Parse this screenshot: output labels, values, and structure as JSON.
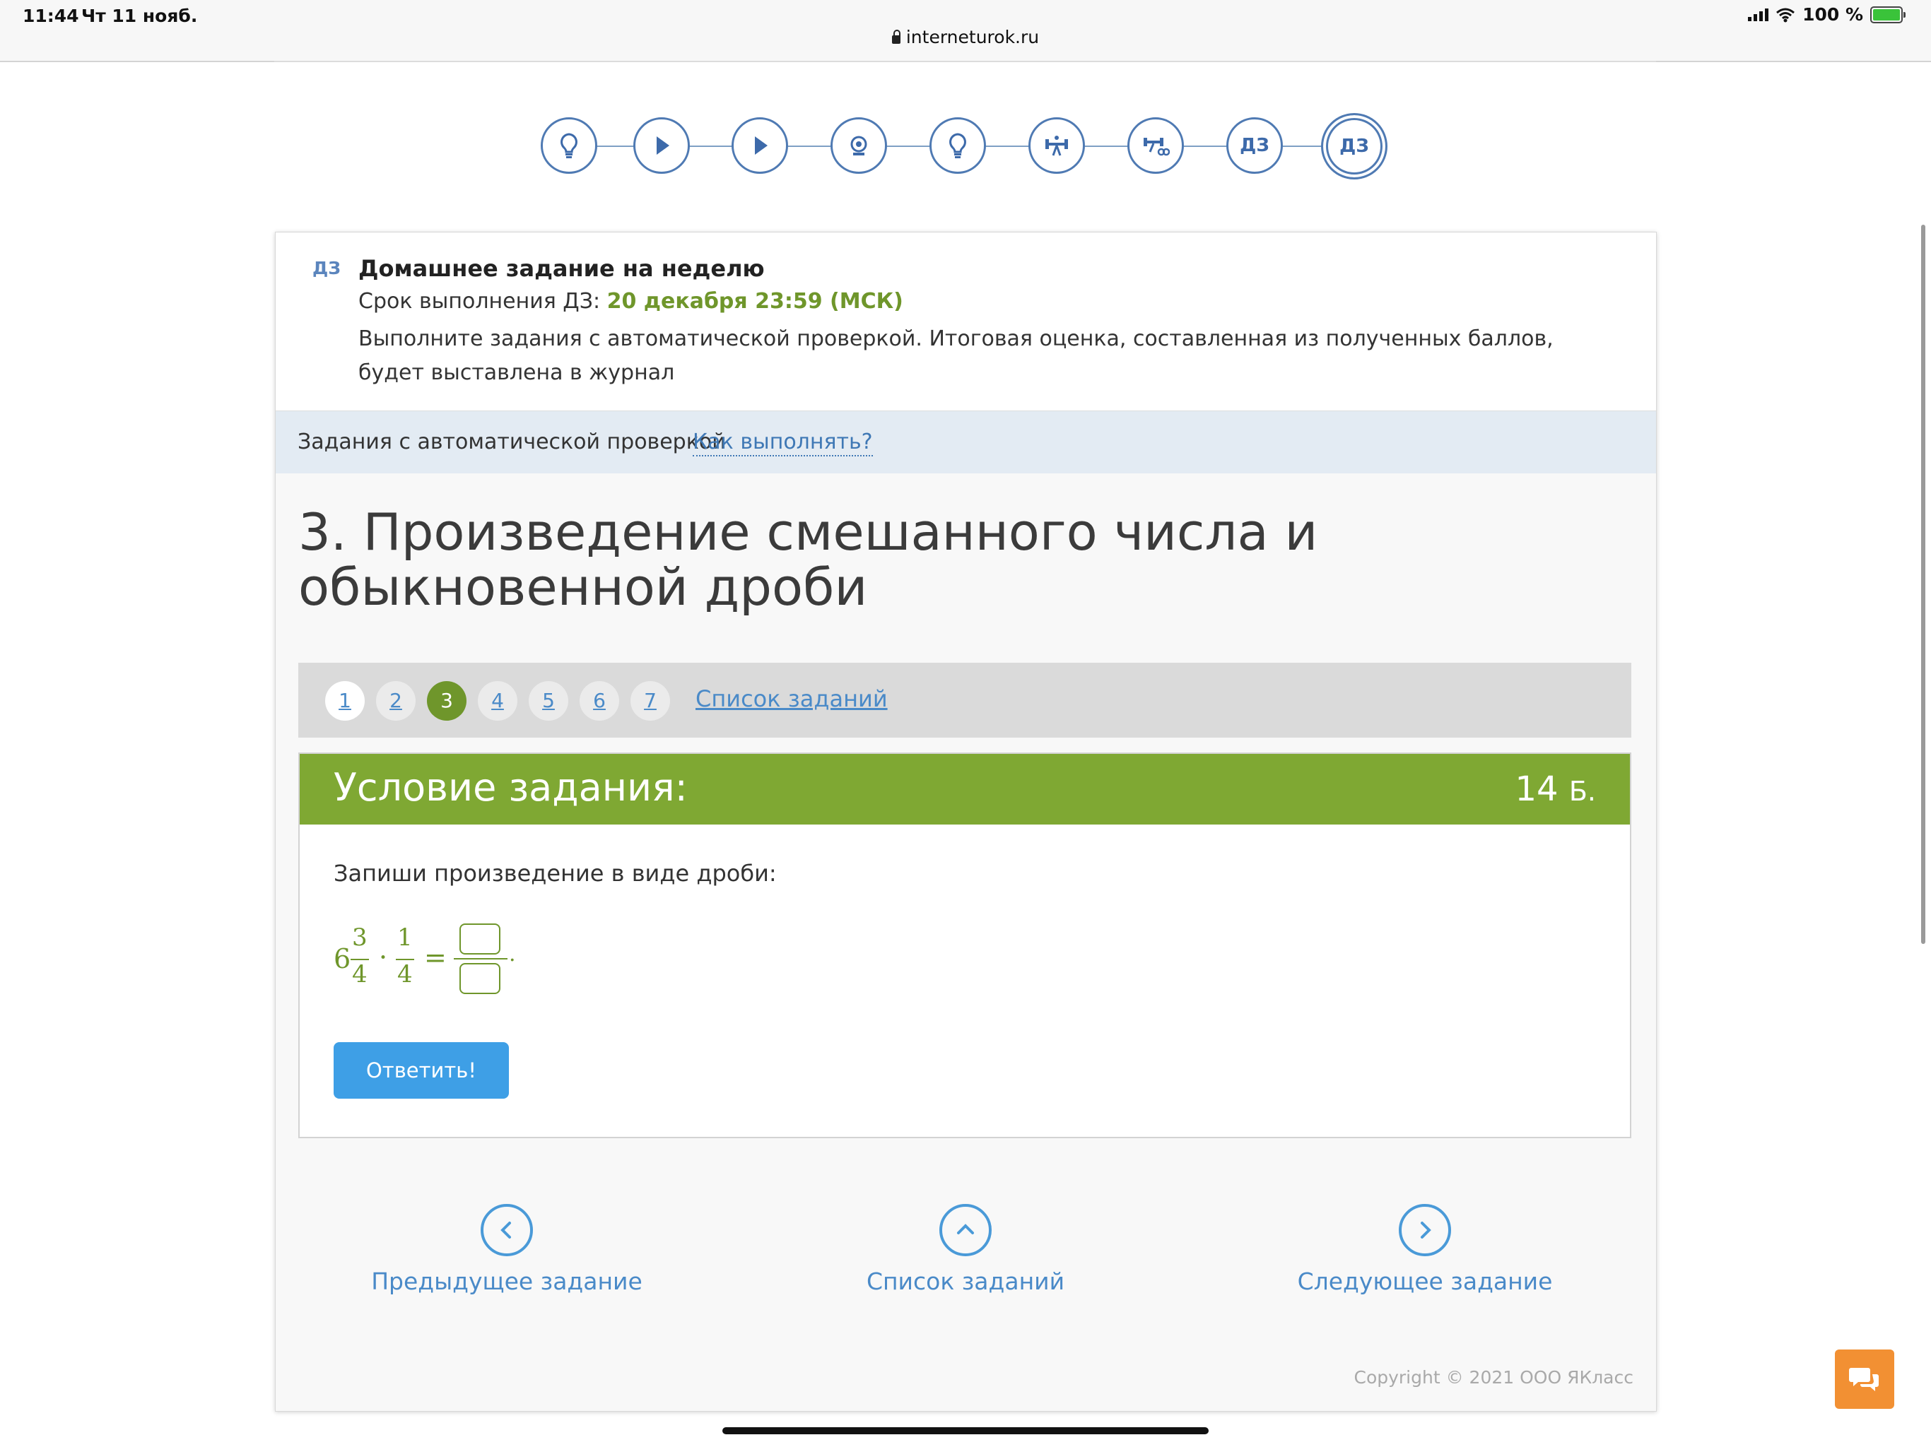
{
  "status_bar": {
    "time": "11:44",
    "date": "Чт 11 нояб.",
    "url": "interneturok.ru",
    "battery": "100 %"
  },
  "steps": [
    {
      "icon": "lightbulb-icon",
      "label": ""
    },
    {
      "icon": "play-icon",
      "label": ""
    },
    {
      "icon": "play-icon",
      "label": ""
    },
    {
      "icon": "webcam-icon",
      "label": ""
    },
    {
      "icon": "lightbulb-icon",
      "label": ""
    },
    {
      "icon": "dumbbell-icon",
      "label": ""
    },
    {
      "icon": "dumbbell-infinity-icon",
      "label": ""
    },
    {
      "icon": "homework-icon",
      "label": "ДЗ"
    },
    {
      "icon": "homework-icon",
      "label": "ДЗ",
      "active": true
    }
  ],
  "homework": {
    "tag": "ДЗ",
    "title": "Домашнее задание на неделю",
    "deadline_label": "Срок выполнения ДЗ: ",
    "deadline_value": "20 декабря 23:59 (МСК)",
    "description": "Выполните задания с автоматической проверкой. Итоговая оценка, составленная из полученных баллов, будет выставлена в журнал"
  },
  "auto_bar": {
    "label": "Задания с автоматической проверкой",
    "how_link": "Как выполнять?"
  },
  "task": {
    "title": "3. Произведение смешанного числа и обыкновенной дроби"
  },
  "pager": {
    "pages": [
      "1",
      "2",
      "3",
      "4",
      "5",
      "6",
      "7"
    ],
    "current": "3",
    "list_link": "Список заданий"
  },
  "condition": {
    "header": "Условие задания:",
    "points_value": "14",
    "points_unit": "Б.",
    "text": "Запиши произведение в виде дроби:",
    "math": {
      "whole": "6",
      "num1": "3",
      "den1": "4",
      "dot": "·",
      "num2": "1",
      "den2": "4",
      "equals": "=",
      "period": "."
    },
    "answer_numerator": "",
    "answer_denominator": "",
    "submit_label": "Ответить!"
  },
  "bottom_nav": {
    "prev": "Предыдущее задание",
    "list": "Список заданий",
    "next": "Следующее задание"
  },
  "copyright": "Copyright © 2021 ООО ЯКласс",
  "colors": {
    "accent_green": "#7fa833",
    "text_green": "#6f962b",
    "link_blue": "#4a8ac8",
    "button_blue": "#3e9fe6",
    "step_blue": "#4f7ab3",
    "chat_orange": "#f29033",
    "info_bar": "#e3ebf3"
  }
}
